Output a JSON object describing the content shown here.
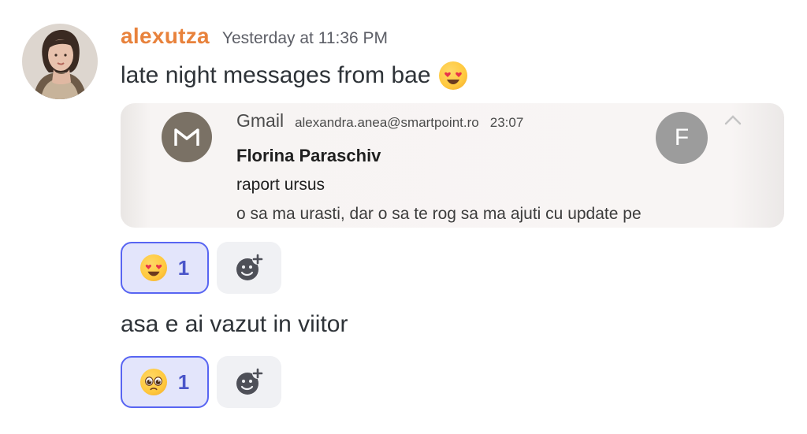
{
  "message": {
    "username": "alexutza",
    "timestamp": "Yesterday at 11:36 PM",
    "username_color": "#e8823c",
    "avatar_icon": "user-avatar-photo"
  },
  "first_line": {
    "text": "late night messages from bae",
    "emoji": "heart-eyes-emoji"
  },
  "embed": {
    "app": "Gmail",
    "app_icon": "gmail-m-icon",
    "email": "alexandra.anea@smartpoint.ro",
    "time": "23:07",
    "sender": "Florina Paraschiv",
    "subject": "raport ursus",
    "preview": "o sa ma urasti, dar o sa te rog sa ma ajuti cu update pe",
    "avatar_letter": "F",
    "collapse_icon": "chevron-up-icon"
  },
  "reaction_1": {
    "emoji": "heart-eyes-emoji",
    "count": "1"
  },
  "second_line": {
    "text": "asa e ai vazut in viitor"
  },
  "reaction_2": {
    "emoji": "pleading-face-emoji",
    "count": "1"
  },
  "add_reaction_icon": "add-reaction-icon",
  "colors": {
    "accent": "#5865f2",
    "reaction_bg": "#e3e5fb",
    "add_bg": "#f0f1f4"
  }
}
